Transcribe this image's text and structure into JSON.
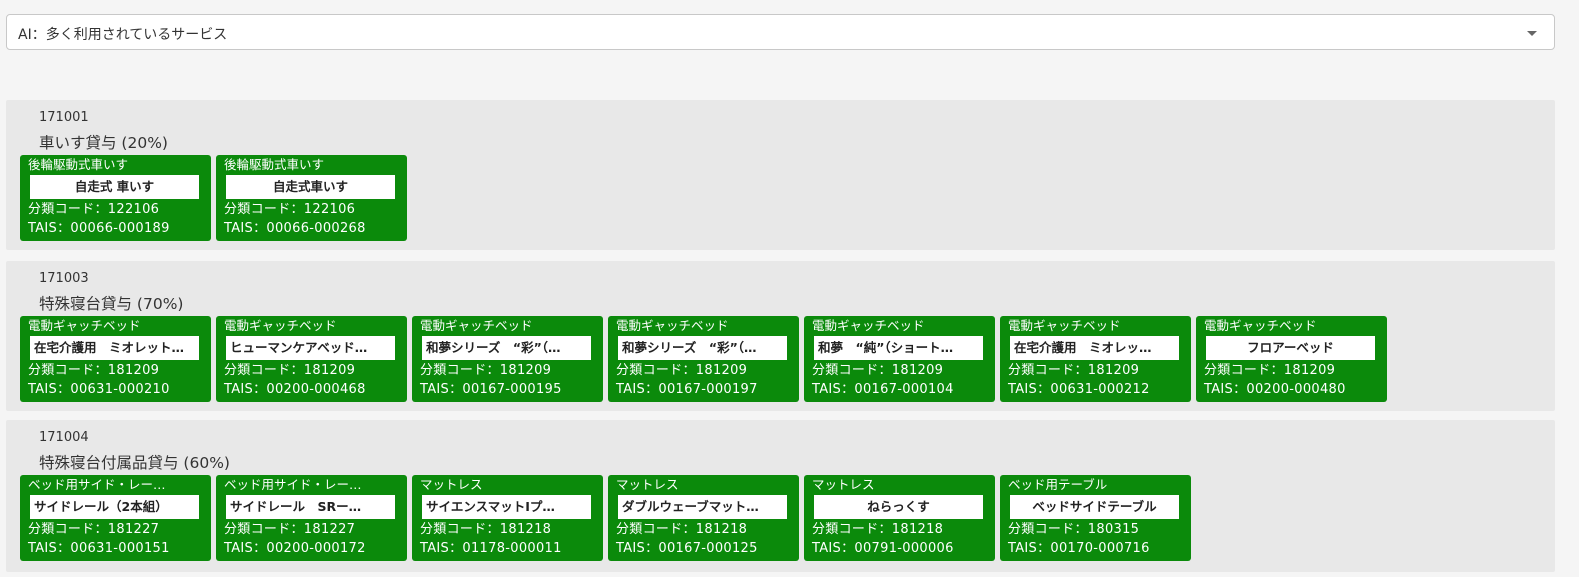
{
  "select": {
    "value": "AI：多く利用されているサービス"
  },
  "groups": [
    {
      "code": "171001",
      "title": "車いす貸与 (20%)",
      "cards": [
        {
          "category": "後輪駆動式車いす",
          "name": "自走式 車いす",
          "classification": "分類コード：122106",
          "tais": "TAIS：00066-000189",
          "align": "center"
        },
        {
          "category": "後輪駆動式車いす",
          "name": "自走式車いす",
          "classification": "分類コード：122106",
          "tais": "TAIS：00066-000268",
          "align": "center"
        }
      ]
    },
    {
      "code": "171003",
      "title": "特殊寝台貸与 (70%)",
      "cards": [
        {
          "category": "電動ギャッチベッド",
          "name": "在宅介護用　ミオレット…",
          "classification": "分類コード：181209",
          "tais": "TAIS：00631-000210",
          "align": "left"
        },
        {
          "category": "電動ギャッチベッド",
          "name": "ヒューマンケアベッド…",
          "classification": "分類コード：181209",
          "tais": "TAIS：00200-000468",
          "align": "left"
        },
        {
          "category": "電動ギャッチベッド",
          "name": "和夢シリーズ　“彩”（…",
          "classification": "分類コード：181209",
          "tais": "TAIS：00167-000195",
          "align": "left"
        },
        {
          "category": "電動ギャッチベッド",
          "name": "和夢シリーズ　“彩”（…",
          "classification": "分類コード：181209",
          "tais": "TAIS：00167-000197",
          "align": "left"
        },
        {
          "category": "電動ギャッチベッド",
          "name": "和夢　“純”（ショート…",
          "classification": "分類コード：181209",
          "tais": "TAIS：00167-000104",
          "align": "left"
        },
        {
          "category": "電動ギャッチベッド",
          "name": "在宅介護用　ミオレッ…",
          "classification": "分類コード：181209",
          "tais": "TAIS：00631-000212",
          "align": "left"
        },
        {
          "category": "電動ギャッチベッド",
          "name": "フロアーベッド",
          "classification": "分類コード：181209",
          "tais": "TAIS：00200-000480",
          "align": "center"
        }
      ]
    },
    {
      "code": "171004",
      "title": "特殊寝台付属品貸与 (60%)",
      "cards": [
        {
          "category": "ベッド用サイド・レー…",
          "name": "サイドレール（2本組）",
          "classification": "分類コード：181227",
          "tais": "TAIS：00631-000151",
          "align": "left"
        },
        {
          "category": "ベッド用サイド・レー…",
          "name": "サイドレール　SRー…",
          "classification": "分類コード：181227",
          "tais": "TAIS：00200-000172",
          "align": "left"
        },
        {
          "category": "マットレス",
          "name": "サイエンスマットIプ…",
          "classification": "分類コード：181218",
          "tais": "TAIS：01178-000011",
          "align": "left"
        },
        {
          "category": "マットレス",
          "name": "ダブルウェーブマット…",
          "classification": "分類コード：181218",
          "tais": "TAIS：00167-000125",
          "align": "left"
        },
        {
          "category": "マットレス",
          "name": "ねらっくす",
          "classification": "分類コード：181218",
          "tais": "TAIS：00791-000006",
          "align": "center"
        },
        {
          "category": "ベッド用テーブル",
          "name": "ベッドサイドテーブル",
          "classification": "分類コード：180315",
          "tais": "TAIS：00170-000716",
          "align": "center"
        }
      ]
    }
  ]
}
